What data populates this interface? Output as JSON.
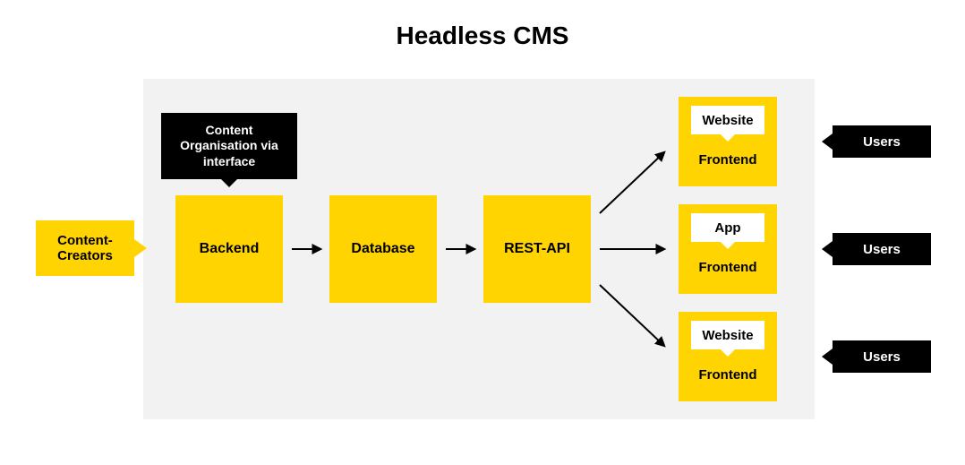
{
  "title": "Headless CMS",
  "creators": "Content-\nCreators",
  "tooltip": "Content Organisation via interface",
  "backend": "Backend",
  "database": "Database",
  "restapi": "REST-API",
  "frontends": [
    {
      "tag": "Website",
      "label": "Frontend"
    },
    {
      "tag": "App",
      "label": "Frontend"
    },
    {
      "tag": "Website",
      "label": "Frontend"
    }
  ],
  "users": "Users"
}
